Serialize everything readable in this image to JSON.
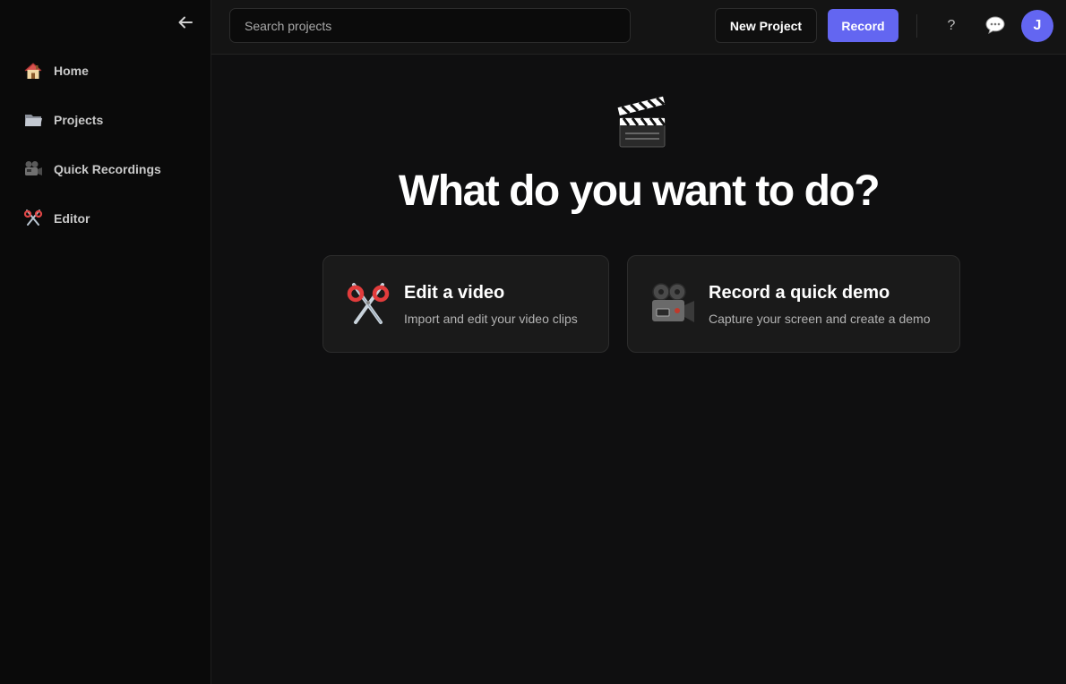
{
  "sidebar": {
    "items": [
      {
        "label": "Home",
        "icon": "house-icon"
      },
      {
        "label": "Projects",
        "icon": "folder-icon"
      },
      {
        "label": "Quick Recordings",
        "icon": "movie-camera-icon"
      },
      {
        "label": "Editor",
        "icon": "scissors-icon"
      }
    ]
  },
  "topbar": {
    "search_placeholder": "Search projects",
    "new_project_label": "New Project",
    "record_label": "Record",
    "help_label": "?",
    "avatar_initial": "J"
  },
  "main": {
    "title": "What do you want to do?",
    "cards": [
      {
        "title": "Edit a video",
        "description": "Import and edit your video clips",
        "icon": "scissors-icon"
      },
      {
        "title": "Record a quick demo",
        "description": "Capture your screen and create a demo",
        "icon": "movie-camera-icon"
      }
    ]
  },
  "colors": {
    "accent": "#6366f1",
    "background": "#0f0f10",
    "sidebar": "#0a0a0a",
    "card": "#1a1a1a"
  }
}
